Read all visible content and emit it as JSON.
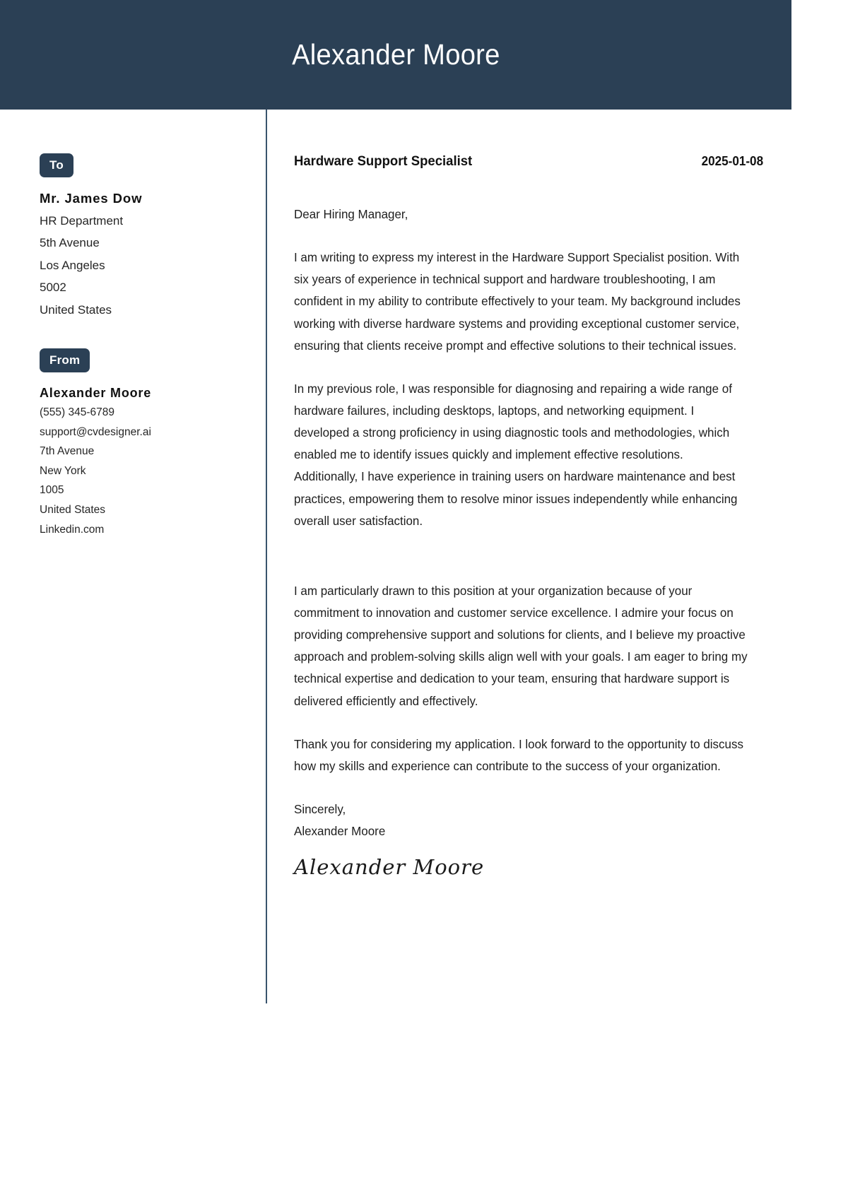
{
  "header": {
    "name": "Alexander Moore",
    "background_color": "#2b4055"
  },
  "sidebar": {
    "to": {
      "badge_label": "To",
      "name": "Mr. James Dow",
      "lines": [
        "HR Department",
        "5th Avenue",
        "Los Angeles",
        "5002",
        "United States"
      ]
    },
    "from": {
      "badge_label": "From",
      "name": "Alexander Moore",
      "lines": [
        "(555) 345-6789",
        "support@cvdesigner.ai",
        "7th Avenue",
        "New York",
        "1005",
        "United States",
        "Linkedin.com"
      ]
    }
  },
  "letter": {
    "job_title": "Hardware Support Specialist",
    "date": "2025-01-08",
    "salutation": "Dear Hiring Manager,",
    "paragraphs": [
      "I am writing to express my interest in the Hardware Support Specialist position. With six years of experience in technical support and hardware troubleshooting, I am confident in my ability to contribute effectively to your team. My background includes working with diverse hardware systems and providing exceptional customer service, ensuring that clients receive prompt and effective solutions to their technical issues.",
      "In my previous role, I was responsible for diagnosing and repairing a wide range of hardware failures, including desktops, laptops, and networking equipment. I developed a strong proficiency in using diagnostic tools and methodologies, which enabled me to identify issues quickly and implement effective resolutions. Additionally, I have experience in training users on hardware maintenance and best practices, empowering them to resolve minor issues independently while enhancing overall user satisfaction.",
      "I am particularly drawn to this position at your organization because of your commitment to innovation and customer service excellence. I admire your focus on providing comprehensive support and solutions for clients, and I believe my proactive approach and problem-solving skills align well with your goals. I am eager to bring my technical expertise and dedication to your team, ensuring that hardware support is delivered efficiently and effectively.",
      "Thank you for considering my application. I look forward to the opportunity to discuss how my skills and experience can contribute to the success of your organization."
    ],
    "closing_salutation": "Sincerely,",
    "closing_name": "Alexander Moore",
    "signature": "Alexander Moore"
  }
}
